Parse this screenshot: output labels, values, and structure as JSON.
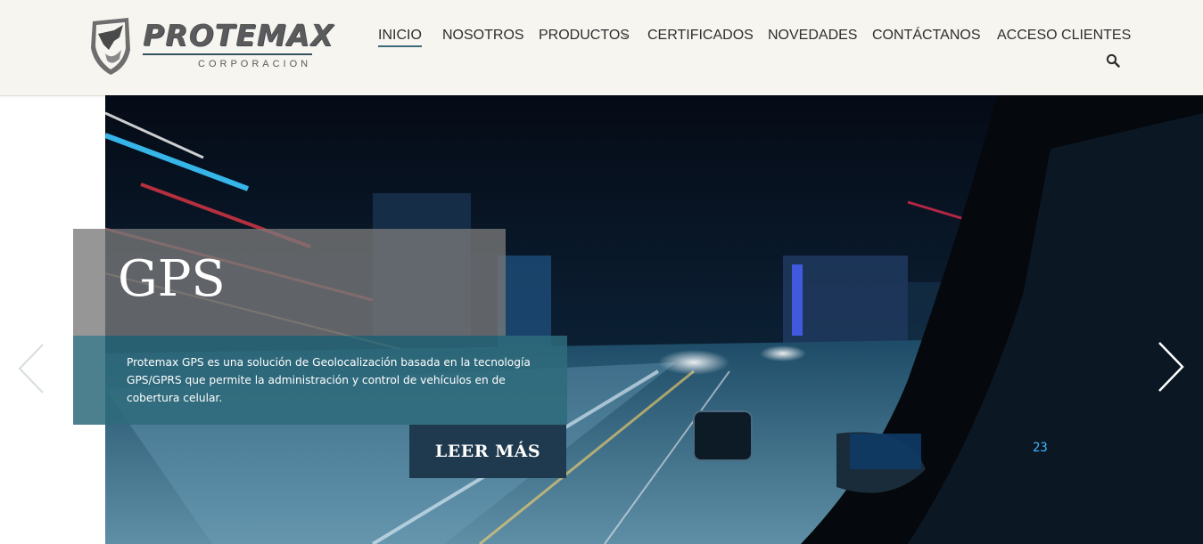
{
  "brand": {
    "name": "PROTEMAX",
    "subtitle": "CORPORACION"
  },
  "nav": {
    "items": [
      "INICIO",
      "NOSOTROS",
      "PRODUCTOS",
      "CERTIFICADOS",
      "NOVEDADES",
      "CONTÁCTANOS",
      "ACCESO CLIENTES"
    ],
    "active": "INICIO"
  },
  "icons": {
    "search": "search-icon",
    "dropdown": "chevron-down-icon",
    "prev": "chevron-left-icon",
    "next": "chevron-right-icon",
    "logo": "shield-rhino-icon"
  },
  "hero": {
    "title": "GPS",
    "description": "Protemax GPS es una solución de Geolocalización basada en la tecnología GPS/GPRS que permite la administración y control de vehículos en de cobertura celular.",
    "cta": "LEER MÁS"
  },
  "colors": {
    "header_bg": "#f7f5f0",
    "accent": "#3d6a7a",
    "desc_bg": "#2f6b7c",
    "cta_bg": "#1f3a4f",
    "title_bg": "#787878"
  }
}
